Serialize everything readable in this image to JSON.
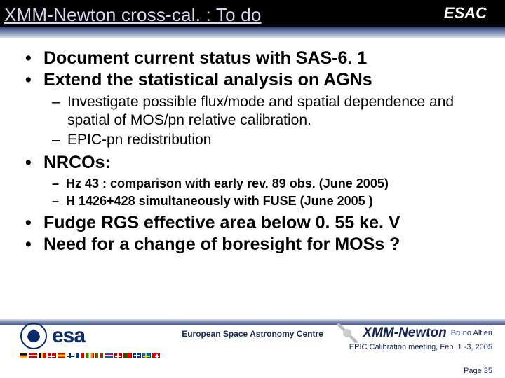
{
  "header": {
    "title": "XMM-Newton cross-cal. : To do",
    "badge": "ESAC"
  },
  "bullets": {
    "b1": "Document current status with SAS-6. 1",
    "b2": "Extend the statistical analysis on AGNs",
    "b2a": "Investigate possible flux/mode and spatial dependence and spatial of MOS/pn relative calibration.",
    "b2b": "EPIC-pn redistribution",
    "b3": "NRCOs:",
    "b3a": "Hz 43 : comparison with early rev. 89 obs. (June 2005)",
    "b3b": "H 1426+428 simultaneously with FUSE (June 2005 )",
    "b4": "Fudge RGS effective area below 0. 55 ke. V",
    "b5": "Need for a change of boresight for MOSs ?"
  },
  "footer": {
    "esa_word": "esa",
    "centre": "European Space Astronomy Centre",
    "mission": "XMM-Newton",
    "author": "Bruno Altieri",
    "meeting": "EPIC Calibration meeting, Feb. 1 -3, 2005",
    "page": "Page 35"
  }
}
